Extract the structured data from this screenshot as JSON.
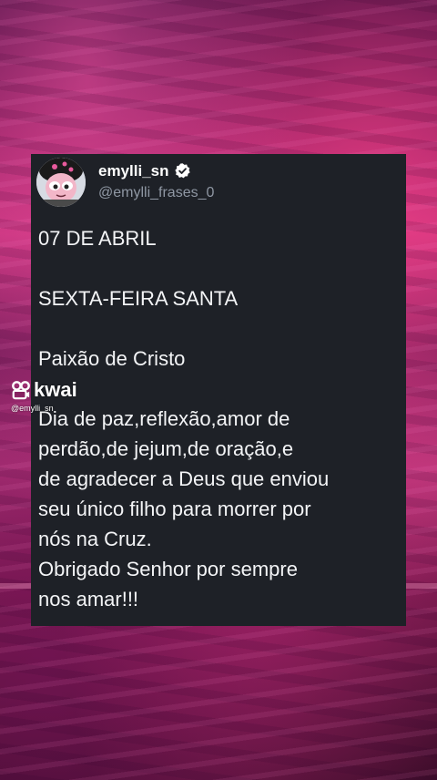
{
  "profile": {
    "display_name": "emylli_sn",
    "handle": "@emylli_frases_0",
    "verified_icon": "verified-badge-icon",
    "avatar_icon": "cartoon-girl-avatar"
  },
  "post": {
    "lines": [
      "07 DE ABRIL",
      "",
      "SEXTA-FEIRA SANTA",
      "",
      "Paixão de Cristo",
      "",
      "Dia de paz,reflexão,amor de",
      "perdão,de jejum,de oração,e",
      "de agradecer a Deus que enviou",
      "seu único filho para morrer por",
      "nós na Cruz.",
      "Obrigado Senhor por sempre",
      "nos amar!!!"
    ]
  },
  "watermark": {
    "brand": "kwai",
    "user": "@emylli_sn",
    "logo_icon": "kwai-logo-icon"
  },
  "colors": {
    "card_bg": "#1e2127",
    "text": "#f3f4f6",
    "handle": "#8f97a3",
    "verified": "#ffffff"
  }
}
